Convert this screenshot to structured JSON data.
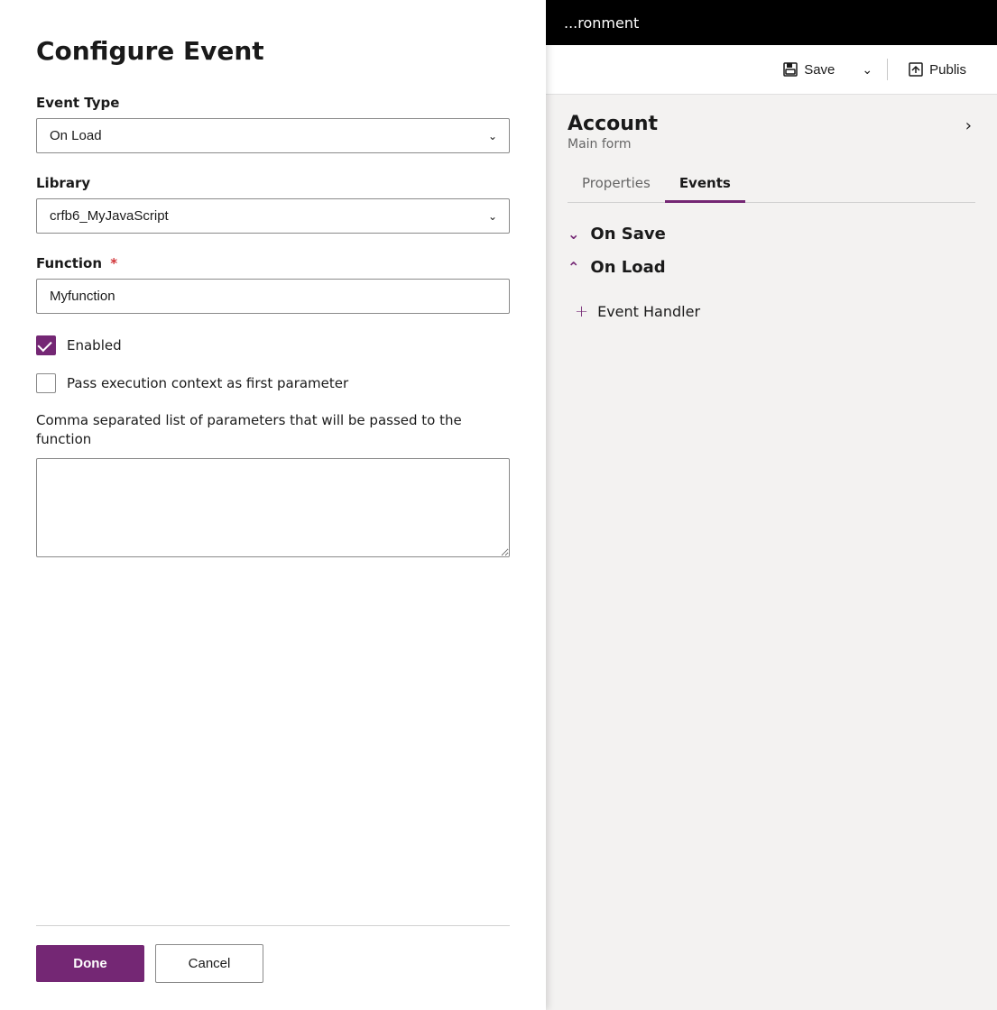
{
  "dialog": {
    "title": "Configure Event",
    "event_type_label": "Event Type",
    "event_type_value": "On Load",
    "library_label": "Library",
    "library_value": "crfb6_MyJavaScript",
    "function_label": "Function",
    "function_required": "*",
    "function_value": "Myfunction",
    "enabled_label": "Enabled",
    "pass_context_label": "Pass execution context as first parameter",
    "params_label": "Comma separated list of parameters that will be passed to the function",
    "params_value": "",
    "done_label": "Done",
    "cancel_label": "Cancel",
    "enabled_checked": true,
    "pass_context_checked": false
  },
  "right_panel": {
    "header_text": "...ronment",
    "save_label": "Save",
    "publish_label": "Publis",
    "account_title": "Account",
    "account_subtitle": "Main form",
    "tab_properties": "Properties",
    "tab_events": "Events",
    "on_save_label": "On Save",
    "on_load_label": "On Load",
    "event_handler_label": "Event Handler"
  }
}
